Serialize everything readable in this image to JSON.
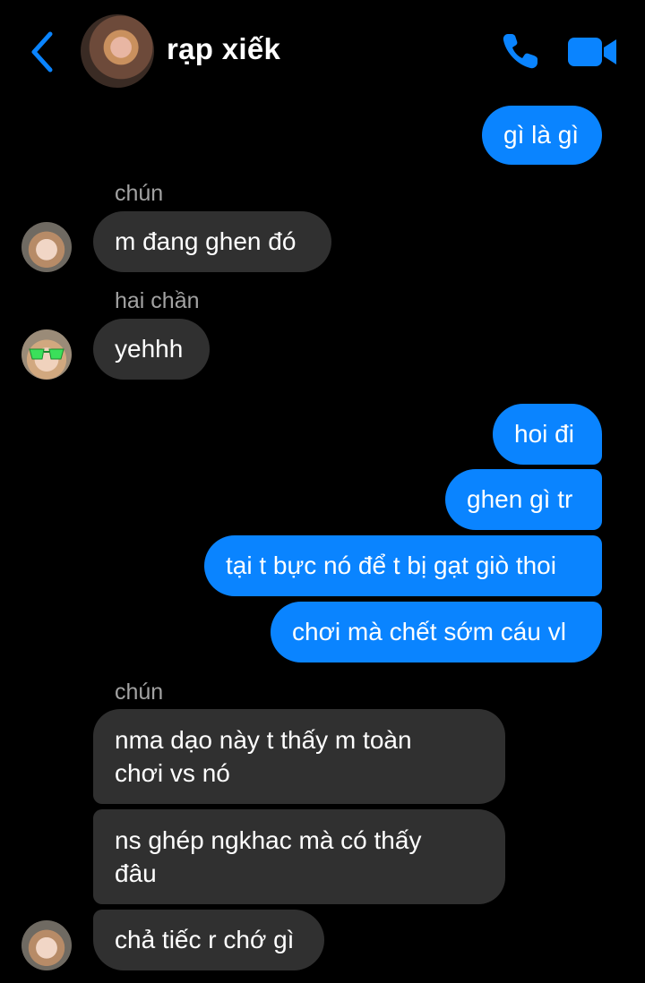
{
  "header": {
    "title": "rạp xiếk",
    "colors": {
      "accent": "#0A84FF"
    },
    "icons": [
      "chevron-left-icon",
      "phone-icon",
      "video-camera-icon"
    ]
  },
  "messages": [
    {
      "sender": "me",
      "text": "gì là gì"
    },
    {
      "sender": "chún",
      "sender_label": "chún",
      "text": "m đang ghen đó"
    },
    {
      "sender": "hai chần",
      "sender_label": "hai chần",
      "text": "yehhh"
    },
    {
      "sender": "me",
      "text": "hoi đi"
    },
    {
      "sender": "me",
      "text": "ghen gì tr"
    },
    {
      "sender": "me",
      "text": "tại t bực nó để t bị gạt giò thoi"
    },
    {
      "sender": "me",
      "text": "chơi mà chết sớm cáu vl"
    },
    {
      "sender": "chún",
      "sender_label": "chún",
      "text_line1": "nma dạo này t thấy m toàn",
      "text_line2": "chơi vs nó"
    },
    {
      "sender": "chún",
      "text_line1": "ns ghép ngkhac mà có thấy",
      "text_line2": "đâu"
    },
    {
      "sender": "chún",
      "text": "chả tiếc r chớ gì"
    }
  ],
  "bubble_colors": {
    "me": "#0A84FF",
    "them": "#303030"
  }
}
